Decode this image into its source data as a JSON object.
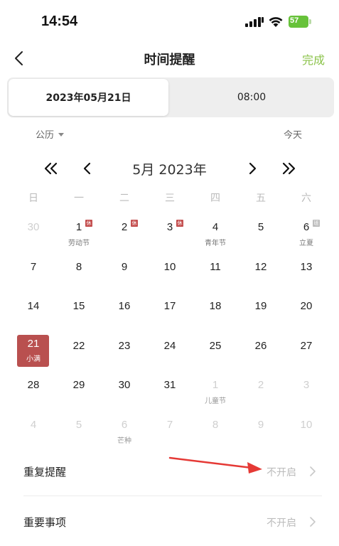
{
  "status": {
    "time": "14:54",
    "battery": "57"
  },
  "nav": {
    "title": "时间提醒",
    "done_label": "完成"
  },
  "segment": {
    "date": "2023年05月21日",
    "time": "08:00"
  },
  "calendar": {
    "type_label": "公历",
    "today_label": "今天",
    "month_label": "5月 2023年",
    "weekdays": [
      "日",
      "一",
      "二",
      "三",
      "四",
      "五",
      "六"
    ],
    "weeks": [
      [
        {
          "n": "30",
          "other": true
        },
        {
          "n": "1",
          "sub": "劳动节",
          "badge": "休"
        },
        {
          "n": "2",
          "badge": "休"
        },
        {
          "n": "3",
          "badge": "休"
        },
        {
          "n": "4",
          "sub": "青年节"
        },
        {
          "n": "5"
        },
        {
          "n": "6",
          "sub": "立夏",
          "badge": "班",
          "badge_type": "work"
        }
      ],
      [
        {
          "n": "7"
        },
        {
          "n": "8"
        },
        {
          "n": "9"
        },
        {
          "n": "10"
        },
        {
          "n": "11"
        },
        {
          "n": "12"
        },
        {
          "n": "13"
        }
      ],
      [
        {
          "n": "14"
        },
        {
          "n": "15"
        },
        {
          "n": "16"
        },
        {
          "n": "17"
        },
        {
          "n": "18"
        },
        {
          "n": "19"
        },
        {
          "n": "20"
        }
      ],
      [
        {
          "n": "21",
          "sub": "小满",
          "selected": true
        },
        {
          "n": "22"
        },
        {
          "n": "23"
        },
        {
          "n": "24"
        },
        {
          "n": "25"
        },
        {
          "n": "26"
        },
        {
          "n": "27"
        }
      ],
      [
        {
          "n": "28"
        },
        {
          "n": "29"
        },
        {
          "n": "30"
        },
        {
          "n": "31"
        },
        {
          "n": "1",
          "sub": "儿童节",
          "other": true
        },
        {
          "n": "2",
          "other": true
        },
        {
          "n": "3",
          "other": true
        }
      ],
      [
        {
          "n": "4",
          "other": true
        },
        {
          "n": "5",
          "other": true
        },
        {
          "n": "6",
          "sub": "芒种",
          "other": true
        },
        {
          "n": "7",
          "other": true
        },
        {
          "n": "8",
          "other": true
        },
        {
          "n": "9",
          "other": true
        },
        {
          "n": "10",
          "other": true
        }
      ]
    ]
  },
  "settings": [
    {
      "label": "重复提醒",
      "value": "不开启"
    },
    {
      "label": "重要事项",
      "value": "不开启"
    }
  ],
  "colors": {
    "accent": "#b9504f",
    "done": "#8bc34a",
    "holiday_badge": "#c44f4f",
    "annotation": "#e53935"
  }
}
